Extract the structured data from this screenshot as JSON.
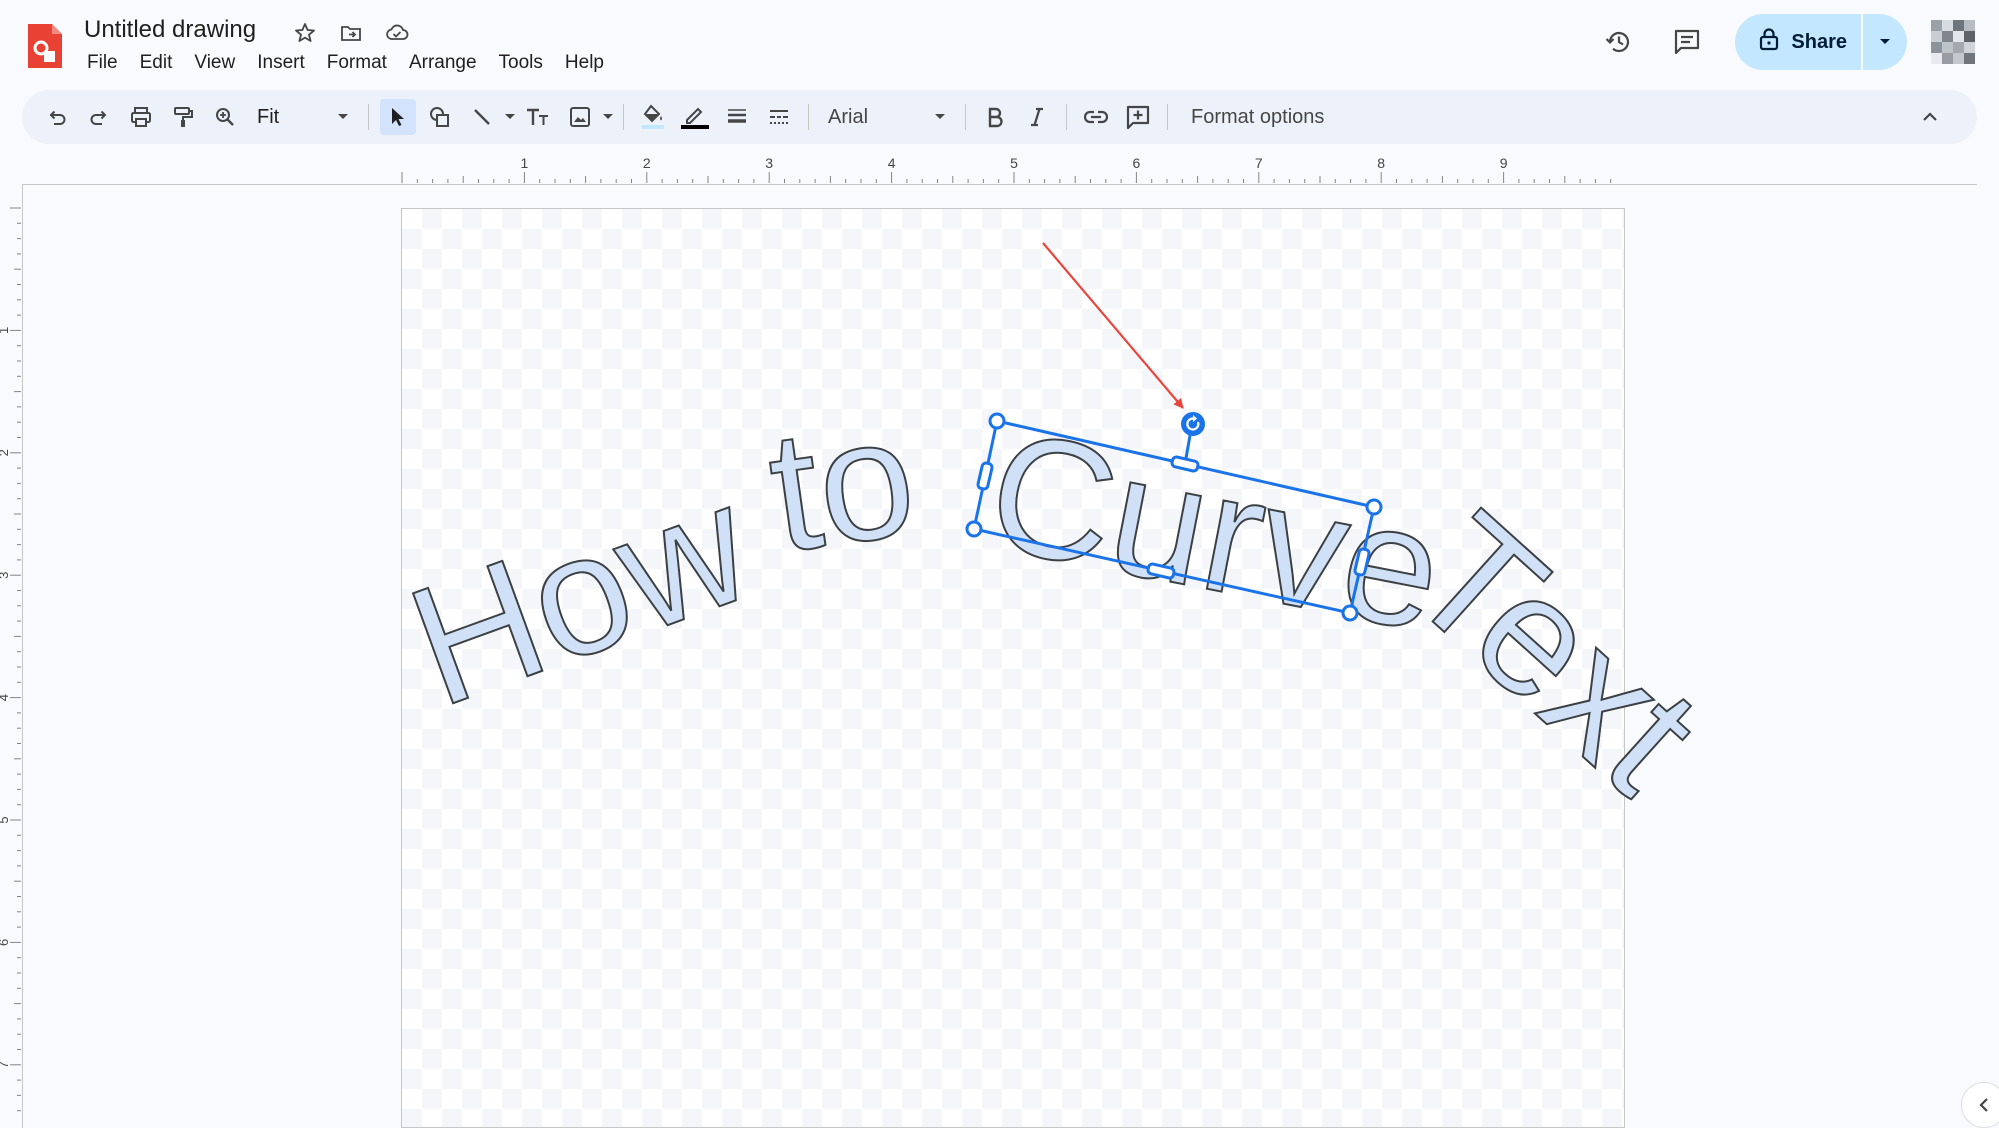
{
  "app": {
    "title": "Untitled drawing",
    "logo_icon": "google-drawings-logo",
    "brand_color": "#e94235"
  },
  "menu": [
    "File",
    "Edit",
    "View",
    "Insert",
    "Format",
    "Arrange",
    "Tools",
    "Help"
  ],
  "header": {
    "share_label": "Share",
    "share_color": "#c2e7ff",
    "icons": [
      "star-icon",
      "move-to-folder-icon",
      "cloud-saved-icon",
      "version-history-icon",
      "comments-icon",
      "lock-icon",
      "chevron-down-icon"
    ]
  },
  "toolbar": {
    "zoom_value": "Fit",
    "font_value": "Arial",
    "format_options_label": "Format options",
    "icons": [
      "undo-icon",
      "redo-icon",
      "print-icon",
      "paint-format-icon",
      "zoom-icon",
      "select-icon",
      "shape-icon",
      "line-icon",
      "text-box-icon",
      "image-icon",
      "fill-color-icon",
      "border-color-icon",
      "border-weight-icon",
      "border-dash-icon",
      "bold-icon",
      "italic-icon",
      "link-icon",
      "comment-add-icon",
      "collapse-toolbar-icon"
    ],
    "accent_color": "#1a73e8"
  },
  "ruler": {
    "horizontal_marks": [
      "1",
      "2",
      "3",
      "4",
      "5",
      "6",
      "7",
      "8",
      "9"
    ],
    "vertical_marks": [
      "1",
      "2",
      "3",
      "4",
      "5",
      "6",
      "7"
    ]
  },
  "canvas": {
    "words": [
      "How",
      "to",
      "Curve",
      "Text"
    ],
    "text_fill": "#cfe0f7",
    "text_stroke": "#3c4043",
    "selection_color": "#1a73e8",
    "annotation_arrow_color": "#e8453c"
  }
}
